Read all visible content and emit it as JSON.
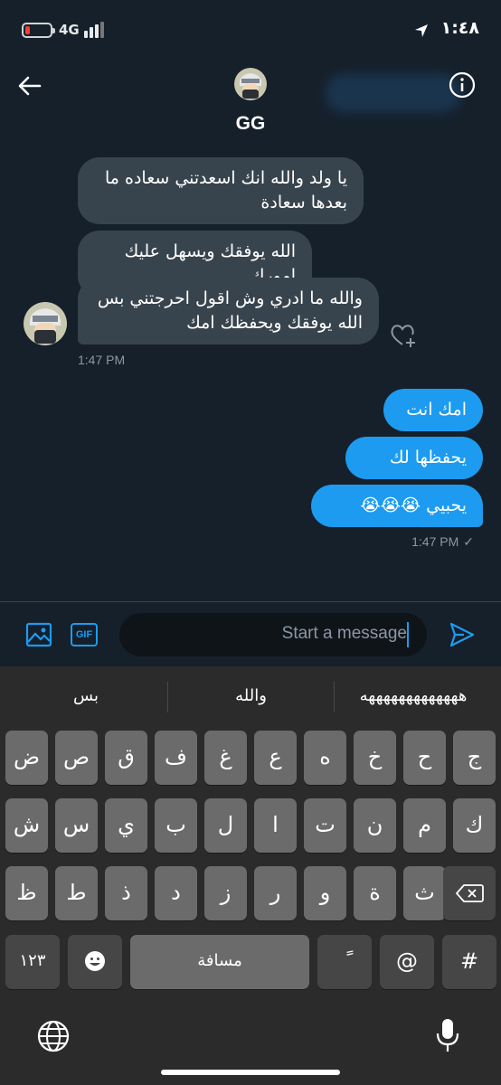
{
  "status": {
    "network": "4G",
    "time": "١:٤٨"
  },
  "header": {
    "title": "GG"
  },
  "messages": {
    "incoming": [
      "يا ولد والله انك اسعدتني سعاده ما بعدها سعادة",
      "الله يوفقك ويسهل عليك امورك",
      "والله ما ادري وش اقول احرجتني بس الله يوفقك ويحفظك امك"
    ],
    "incoming_time": "1:47 PM",
    "outgoing": [
      "امك انت",
      "يحفظها لك",
      "يحبيي 😭😭😭"
    ],
    "outgoing_time": "1:47 PM",
    "outgoing_status": "✓"
  },
  "composer": {
    "placeholder": "Start a message",
    "gif_label": "GIF"
  },
  "keyboard": {
    "suggestions": [
      "هههههههههههههه",
      "والله",
      "بس"
    ],
    "row1": [
      "ض",
      "ص",
      "ق",
      "ف",
      "غ",
      "ع",
      "ه",
      "خ",
      "ح",
      "ج"
    ],
    "row2": [
      "ش",
      "س",
      "ي",
      "ب",
      "ل",
      "ا",
      "ت",
      "ن",
      "م",
      "ك"
    ],
    "row3": [
      "ظ",
      "ط",
      "ذ",
      "د",
      "ز",
      "ر",
      "و",
      "ة",
      "ث"
    ],
    "numbers_key": "١٢٣",
    "space_label": "مسافة",
    "diacritic_key": "ً",
    "at_key": "@",
    "hash_key": "#"
  },
  "colors": {
    "accent": "#1d9bf0",
    "background": "#15202b",
    "incoming_bubble": "#38444d"
  }
}
